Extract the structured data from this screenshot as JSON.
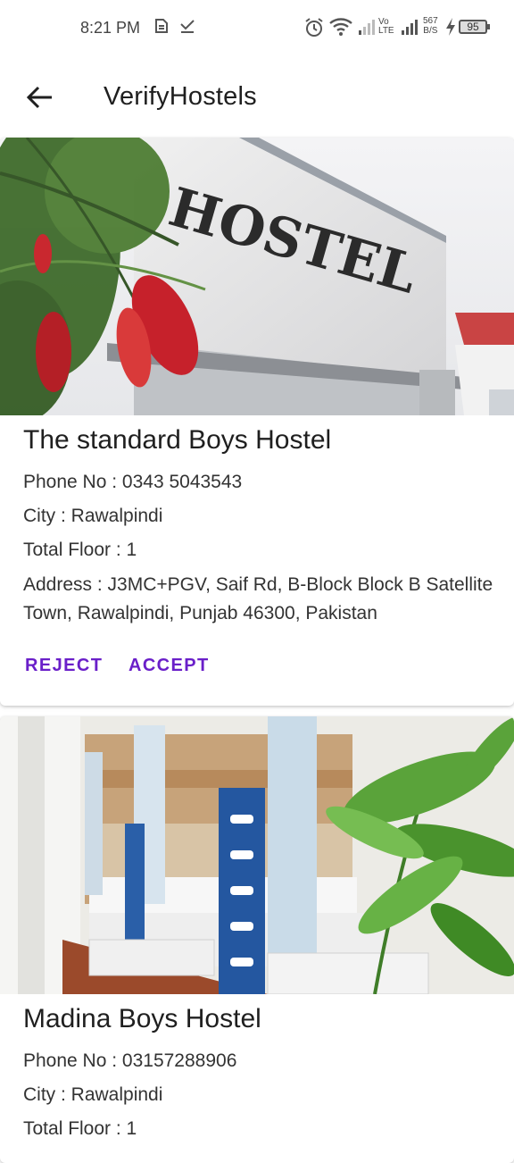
{
  "status_bar": {
    "time": "8:21 PM",
    "network_speed_value": "567",
    "network_speed_unit": "B/S",
    "volte_top": "Vo",
    "volte_bottom": "LTE",
    "battery": "95"
  },
  "app_bar": {
    "title": "VerifyHostels"
  },
  "hostels": [
    {
      "name": "The standard Boys Hostel",
      "phone": "Phone No : 0343 5043543",
      "city": "City : Rawalpindi",
      "floors": "Total Floor : 1",
      "address": "Address : J3MC+PGV, Saif Rd, B-Block Block B Satellite Town, Rawalpindi, Punjab 46300, Pakistan",
      "image_sign_text": "HOSTEL",
      "reject_label": "REJECT",
      "accept_label": "ACCEPT"
    },
    {
      "name": "Madina Boys Hostel",
      "phone": "Phone No : 03157288906",
      "city": "City : Rawalpindi",
      "floors": "Total Floor : 1"
    }
  ],
  "colors": {
    "accent": "#6a1fc9",
    "text": "#1f1f1f"
  }
}
